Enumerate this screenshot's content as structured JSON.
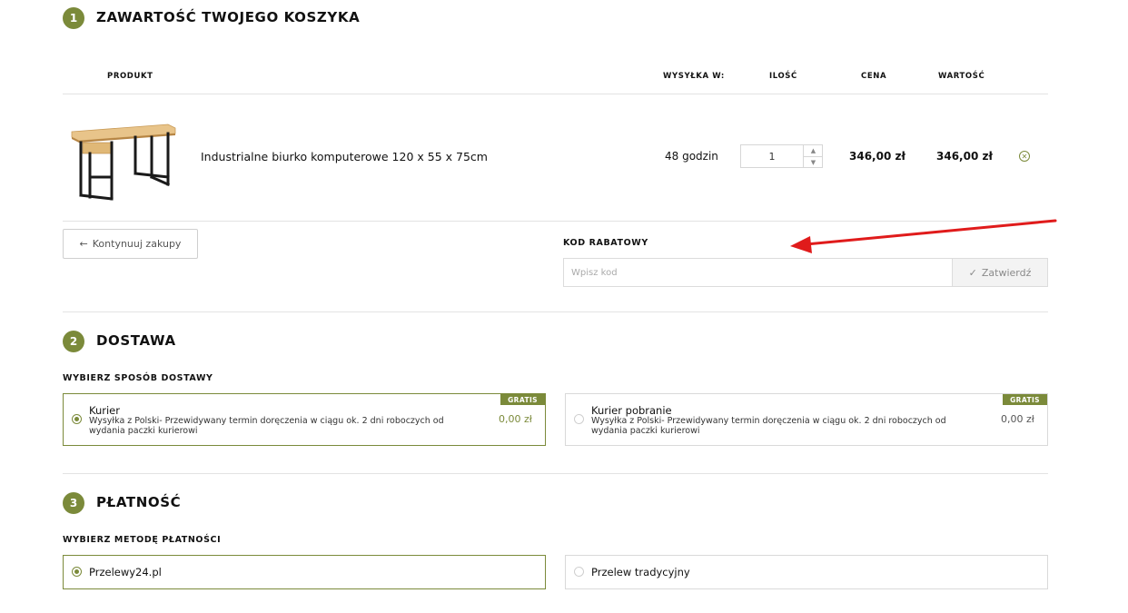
{
  "theme": {
    "accent": "#7b8a3a",
    "arrow": "#e01b1b"
  },
  "cart": {
    "step": "1",
    "title": "ZAWARTOŚĆ TWOJEGO KOSZYKA",
    "columns": {
      "product": "PRODUKT",
      "shipping": "WYSYŁKA W:",
      "quantity": "ILOŚĆ",
      "price": "CENA",
      "value": "WARTOŚĆ"
    },
    "items": [
      {
        "name": "Industrialne biurko komputerowe 120 x 55 x 75cm",
        "shipping": "48 godzin",
        "quantity": "1",
        "price": "346,00 zł",
        "value": "346,00 zł",
        "image_icon": "desk-image",
        "remove_icon": "close-circle-icon"
      }
    ],
    "continue_label": "Kontynuuj zakupy",
    "continue_icon": "arrow-left-icon",
    "coupon": {
      "label": "KOD RABATOWY",
      "placeholder": "Wpisz kod",
      "value": "",
      "button_label": "Zatwierdź",
      "button_icon": "check-icon"
    }
  },
  "delivery": {
    "step": "2",
    "title": "DOSTAWA",
    "subtitle": "WYBIERZ SPOSÓB DOSTAWY",
    "options": [
      {
        "title": "Kurier",
        "desc": "Wysyłka z Polski- Przewidywany termin doręczenia w ciągu ok. 2 dni roboczych od wydania paczki kurierowi",
        "price": "0,00 zł",
        "badge": "GRATIS",
        "selected": true
      },
      {
        "title": "Kurier pobranie",
        "desc": "Wysyłka z Polski- Przewidywany termin doręczenia w ciągu ok. 2 dni roboczych od wydania paczki kurierowi",
        "price": "0,00 zł",
        "badge": "GRATIS",
        "selected": false
      }
    ]
  },
  "payment": {
    "step": "3",
    "title": "PŁATNOŚĆ",
    "subtitle": "WYBIERZ METODĘ PŁATNOŚCI",
    "options": [
      {
        "title": "Przelewy24.pl",
        "selected": true
      },
      {
        "title": "Przelew tradycyjny",
        "selected": false
      }
    ]
  }
}
